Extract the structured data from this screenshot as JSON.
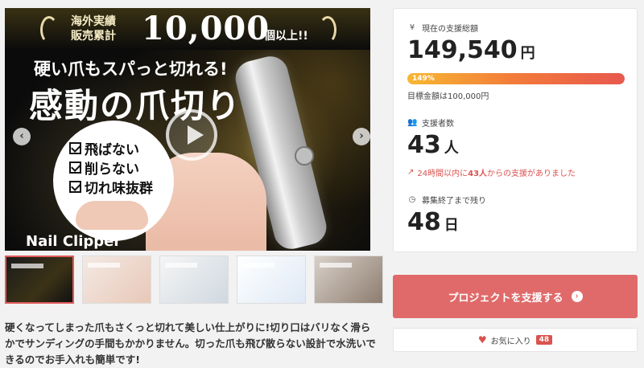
{
  "hero": {
    "badge_line1": "海外実績",
    "badge_line2": "販売累計",
    "big_number": "10,000",
    "number_suffix": "個以上!!",
    "tagline": "硬い爪もスパっと切れる!",
    "headline": "感動の爪切り",
    "features": [
      "飛ばない",
      "削らない",
      "切れ味抜群"
    ],
    "product_name": "Nail Clipper"
  },
  "controls": {
    "prev_icon": "‹",
    "next_icon": "›"
  },
  "description": "硬くなってしまった爪もさくっと切れて美しい仕上がりに!切り口はバリなく滑らかでサンディングの手間もかかりません。切った爪も飛び散らない設計で水洗いできるのでお手入れも簡単です!",
  "stats": {
    "total_label": "現在の支援総額",
    "total_icon": "yen-icon",
    "total_value": "149,540",
    "total_unit": "円",
    "progress_percent": 149,
    "progress_text": "149%",
    "goal_text": "目標金額は100,000円",
    "supporters_label": "支援者数",
    "supporters_icon": "people-icon",
    "supporters_value": "43",
    "supporters_unit": "人",
    "trend_prefix": "24時間以内に",
    "trend_count": "43人",
    "trend_suffix": "からの支援がありました",
    "days_label": "募集終了まで残り",
    "days_icon": "clock-icon",
    "days_value": "48",
    "days_unit": "日"
  },
  "actions": {
    "support_label": "プロジェクトを支援する",
    "favorite_label": "お気に入り",
    "favorite_count": "48"
  },
  "colors": {
    "accent": "#e06a6a",
    "progress_start": "#f7b733",
    "progress_end": "#e8584f",
    "trend": "#d9534f"
  }
}
